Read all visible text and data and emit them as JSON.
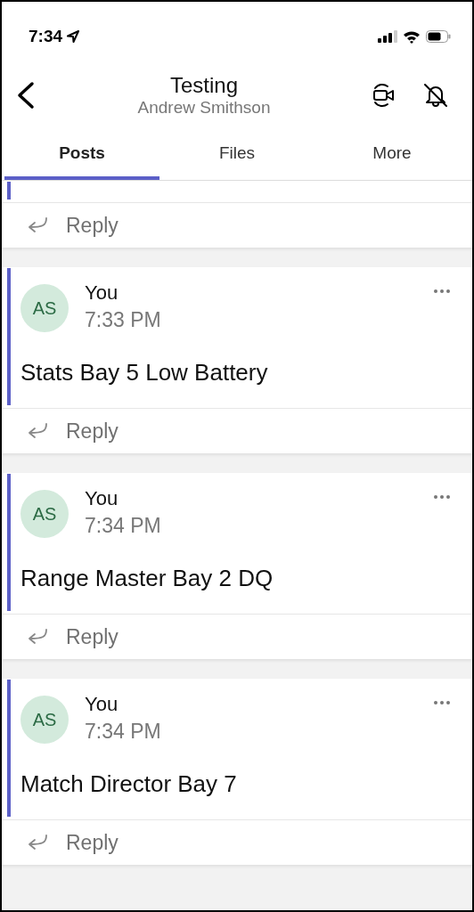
{
  "status_bar": {
    "time": "7:34"
  },
  "header": {
    "title": "Testing",
    "subtitle": "Andrew Smithson"
  },
  "tabs": [
    {
      "label": "Posts",
      "selected": true
    },
    {
      "label": "Files",
      "selected": false
    },
    {
      "label": "More",
      "selected": false
    }
  ],
  "top_reply": {
    "label": "Reply"
  },
  "posts": [
    {
      "initials": "AS",
      "author": "You",
      "time": "7:33 PM",
      "body": "Stats Bay 5 Low Battery",
      "reply": "Reply"
    },
    {
      "initials": "AS",
      "author": "You",
      "time": "7:34 PM",
      "body": "Range Master Bay 2 DQ",
      "reply": "Reply"
    },
    {
      "initials": "AS",
      "author": "You",
      "time": "7:34 PM",
      "body": "Match Director Bay 7",
      "reply": "Reply"
    }
  ]
}
